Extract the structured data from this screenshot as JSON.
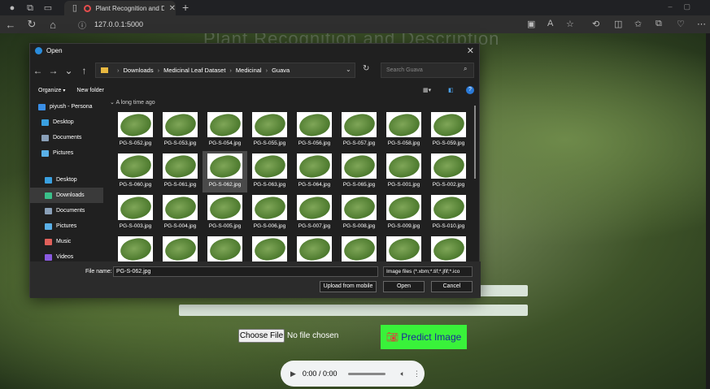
{
  "browser": {
    "tab_title": "Plant Recognition and Desc",
    "url": "127.0.0.1:5000"
  },
  "page": {
    "title": "Plant Recognition and Description",
    "choose_label": "Choose File",
    "no_file": "No file chosen",
    "predict_label": "Predict Image",
    "audio_time": "0:00 / 0:00"
  },
  "dialog": {
    "title": "Open",
    "breadcrumb": [
      "Downloads",
      "Medicinal Leaf Dataset",
      "Medicinal",
      "Guava"
    ],
    "search_placeholder": "Search Guava",
    "organize": "Organize",
    "new_folder": "New folder",
    "group_header": "A long time ago",
    "sidebar": [
      {
        "label": "piyush - Persona",
        "color": "#3a8ee6"
      },
      {
        "label": "Desktop",
        "color": "#3aa0e0"
      },
      {
        "label": "Documents",
        "color": "#8aa0b8"
      },
      {
        "label": "Pictures",
        "color": "#5ab0e8"
      },
      {
        "label": "Desktop",
        "color": "#3aa0e0"
      },
      {
        "label": "Downloads",
        "color": "#3ac08a"
      },
      {
        "label": "Documents",
        "color": "#8aa0b8"
      },
      {
        "label": "Pictures",
        "color": "#5ab0e8"
      },
      {
        "label": "Music",
        "color": "#e0605a"
      },
      {
        "label": "Videos",
        "color": "#8a5ae0"
      }
    ],
    "files": [
      "PG-S-052.jpg",
      "PG-S-053.jpg",
      "PG-S-054.jpg",
      "PG-S-055.jpg",
      "PG-S-056.jpg",
      "PG-S-057.jpg",
      "PG-S-058.jpg",
      "PG-S-059.jpg",
      "PG-S-060.jpg",
      "PG-S-061.jpg",
      "PG-S-062.jpg",
      "PG-S-063.jpg",
      "PG-S-064.jpg",
      "PG-S-065.jpg",
      "PG-S-001.jpg",
      "PG-S-002.jpg",
      "PG-S-003.jpg",
      "PG-S-004.jpg",
      "PG-S-005.jpg",
      "PG-S-006.jpg",
      "PG-S-007.jpg",
      "PG-S-008.jpg",
      "PG-S-009.jpg",
      "PG-S-010.jpg",
      "",
      "",
      "",
      "",
      "",
      "",
      "",
      ""
    ],
    "selected_file": "PG-S-062.jpg",
    "file_name_label": "File name:",
    "file_name": "PG-S-062.jpg",
    "file_type": "Image files (*.xbm;*.tif;*.jfif;*.ico",
    "upload_mobile": "Upload from mobile",
    "open": "Open",
    "cancel": "Cancel"
  }
}
